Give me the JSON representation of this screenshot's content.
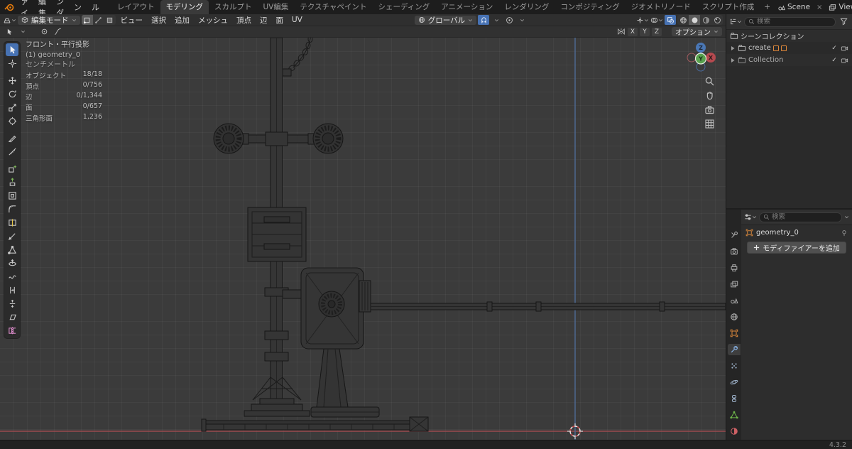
{
  "topbar": {
    "app_menus": [
      "ファイル",
      "編集",
      "レンダー",
      "ウィンドウ",
      "ヘルプ"
    ],
    "workspaces": [
      "レイアウト",
      "モデリング",
      "スカルプト",
      "UV編集",
      "テクスチャペイント",
      "シェーディング",
      "アニメーション",
      "レンダリング",
      "コンポジティング",
      "ジオメトリノード",
      "スクリプト作成"
    ],
    "new_workspace_label": "+",
    "scene_label": "Scene",
    "viewlayer_label": "ViewLayer"
  },
  "viewport_header": {
    "mode_label": "編集モード",
    "menus": [
      "ビュー",
      "選択",
      "追加",
      "メッシュ",
      "頂点",
      "辺",
      "面",
      "UV"
    ],
    "orientation_label": "グローバル"
  },
  "tool_settings": {
    "mirror_axes": [
      "X",
      "Y",
      "Z"
    ],
    "options_label": "オプション"
  },
  "viewport": {
    "view_label": "フロント・平行投影",
    "selection_label": "(1) geometry_0",
    "units_label": "センチメートル",
    "stats": [
      {
        "label": "オブジェクト",
        "value": "18/18"
      },
      {
        "label": "頂点",
        "value": "0/756"
      },
      {
        "label": "辺",
        "value": "0/1,344"
      },
      {
        "label": "面",
        "value": "0/657"
      },
      {
        "label": "三角形面",
        "value": "1,236"
      }
    ],
    "gizmo": {
      "x": "X",
      "y": "Y",
      "z": "Z"
    }
  },
  "outliner": {
    "search_placeholder": "検索",
    "rows": [
      {
        "label": "シーンコレクション"
      },
      {
        "label": "create"
      },
      {
        "label": "Collection"
      }
    ]
  },
  "properties": {
    "search_placeholder": "検索",
    "object_name": "geometry_0",
    "add_modifier_label": "モディファイアーを追加"
  },
  "statusbar": {
    "version": "4.3.2"
  },
  "colors": {
    "accent_blue": "#4772b3",
    "axis_x_red": "#9a4a4e",
    "axis_z_blue": "#4e6a94",
    "collection_orange": "#e0883a",
    "data_green": "#6fb54a",
    "material_red": "#cd6064"
  }
}
